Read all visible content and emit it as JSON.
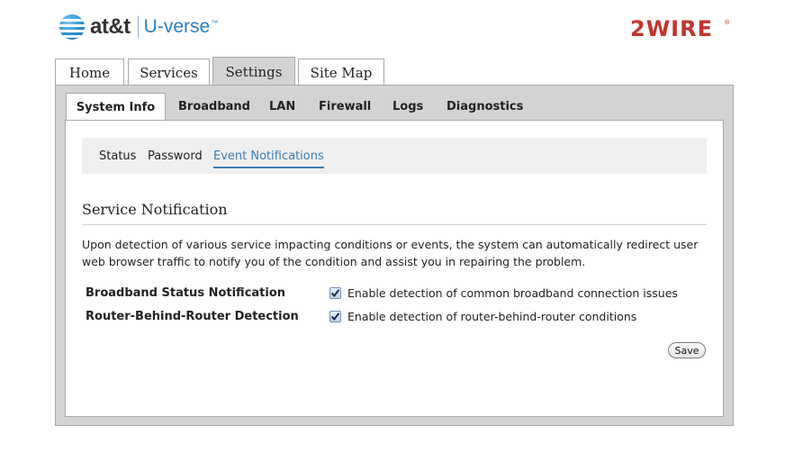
{
  "header": {
    "brand_name": "at&t",
    "brand_product": "U-verse",
    "brand_tm": "™",
    "vendor_logo_text": "2WIRE",
    "vendor_logo_mark": "®"
  },
  "top_tabs": [
    "Home",
    "Services",
    "Settings",
    "Site Map"
  ],
  "top_tabs_active": "Settings",
  "sub_tabs": [
    "System Info",
    "Broadband",
    "LAN",
    "Firewall",
    "Logs",
    "Diagnostics"
  ],
  "sub_tabs_active": "System Info",
  "sub_nav": [
    "Status",
    "Password",
    "Event Notifications"
  ],
  "sub_nav_active": "Event Notifications",
  "section": {
    "title": "Service Notification",
    "description_line1": "Upon detection of various service impacting conditions or events, the system can automatically redirect user",
    "description_line2": "web browser traffic to notify you of the condition and assist you in repairing the problem."
  },
  "options": [
    {
      "label": "Broadband Status Notification",
      "checkbox_text": "Enable detection of common broadband connection issues",
      "checked": true
    },
    {
      "label": "Router-Behind-Router Detection",
      "checkbox_text": "Enable detection of router-behind-router conditions",
      "checked": true
    }
  ],
  "save_label": "Save",
  "colors": {
    "link_active": "#3b7bb5",
    "vendor_red": "#c3342c",
    "panel_gray": "#d3d3d3",
    "subnav_bg": "#efefef"
  }
}
